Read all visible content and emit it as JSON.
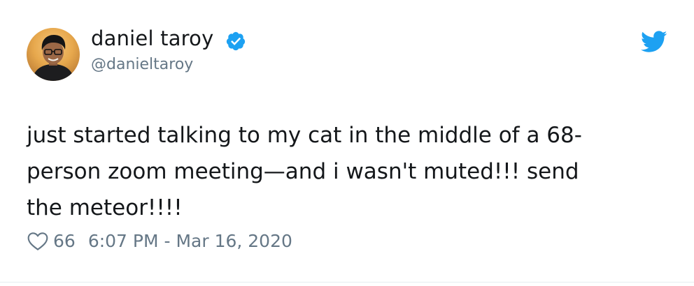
{
  "tweet": {
    "author": {
      "display_name": "daniel taroy",
      "handle": "@danieltaroy",
      "verified": true,
      "avatar_icon": "profile-photo"
    },
    "text": "just started talking to my cat in the middle of a 68-\nperson zoom meeting—and i wasn't muted!!! send\nthe meteor!!!!",
    "likes": "66",
    "timestamp": "6:07 PM - Mar 16, 2020",
    "icons": {
      "verified": "verified-badge-icon",
      "brand": "twitter-bird-icon",
      "like": "heart-icon"
    },
    "colors": {
      "brand_blue": "#1da1f2",
      "text": "#14171a",
      "secondary_text": "#657786"
    }
  }
}
